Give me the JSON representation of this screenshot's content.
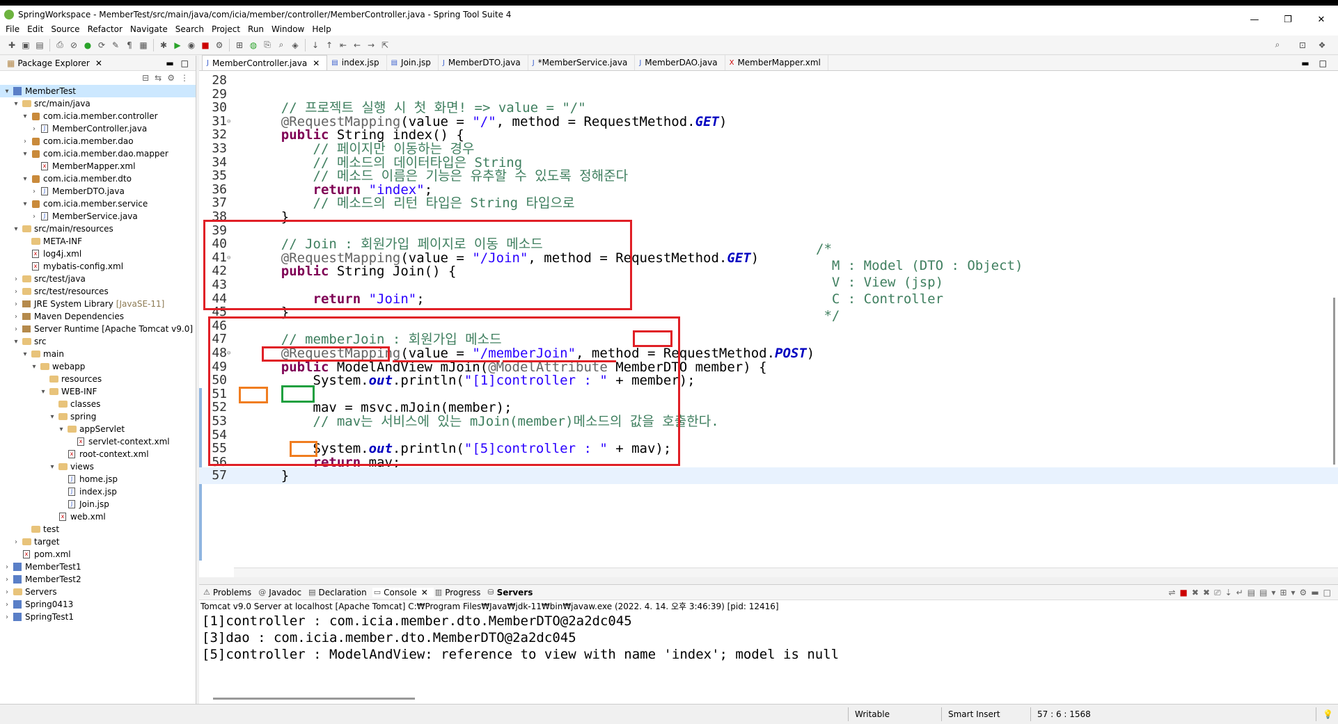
{
  "window": {
    "title": "SpringWorkspace - MemberTest/src/main/java/com/icia/member/controller/MemberController.java - Spring Tool Suite 4",
    "minimize": "—",
    "restore": "❐",
    "close": "✕"
  },
  "menu": [
    "File",
    "Edit",
    "Source",
    "Refactor",
    "Navigate",
    "Search",
    "Project",
    "Run",
    "Window",
    "Help"
  ],
  "package_explorer": {
    "title": "Package Explorer",
    "tree": [
      {
        "label": "MemberTest",
        "depth": 0,
        "arrow": "▾",
        "icon": "project",
        "selected": true
      },
      {
        "label": "src/main/java",
        "depth": 1,
        "arrow": "▾",
        "icon": "folder"
      },
      {
        "label": "com.icia.member.controller",
        "depth": 2,
        "arrow": "▾",
        "icon": "package"
      },
      {
        "label": "MemberController.java",
        "depth": 3,
        "arrow": "›",
        "icon": "java"
      },
      {
        "label": "com.icia.member.dao",
        "depth": 2,
        "arrow": "›",
        "icon": "package"
      },
      {
        "label": "com.icia.member.dao.mapper",
        "depth": 2,
        "arrow": "▾",
        "icon": "package"
      },
      {
        "label": "MemberMapper.xml",
        "depth": 3,
        "arrow": "",
        "icon": "xml"
      },
      {
        "label": "com.icia.member.dto",
        "depth": 2,
        "arrow": "▾",
        "icon": "package"
      },
      {
        "label": "MemberDTO.java",
        "depth": 3,
        "arrow": "›",
        "icon": "java"
      },
      {
        "label": "com.icia.member.service",
        "depth": 2,
        "arrow": "▾",
        "icon": "package"
      },
      {
        "label": "MemberService.java",
        "depth": 3,
        "arrow": "›",
        "icon": "java"
      },
      {
        "label": "src/main/resources",
        "depth": 1,
        "arrow": "▾",
        "icon": "folder"
      },
      {
        "label": "META-INF",
        "depth": 2,
        "arrow": "",
        "icon": "folder"
      },
      {
        "label": "log4j.xml",
        "depth": 2,
        "arrow": "",
        "icon": "xml"
      },
      {
        "label": "mybatis-config.xml",
        "depth": 2,
        "arrow": "",
        "icon": "xml"
      },
      {
        "label": "src/test/java",
        "depth": 1,
        "arrow": "›",
        "icon": "folder"
      },
      {
        "label": "src/test/resources",
        "depth": 1,
        "arrow": "›",
        "icon": "folder"
      },
      {
        "label": "JRE System Library",
        "suffix": "[JavaSE-11]",
        "depth": 1,
        "arrow": "›",
        "icon": "library"
      },
      {
        "label": "Maven Dependencies",
        "depth": 1,
        "arrow": "›",
        "icon": "library"
      },
      {
        "label": "Server Runtime [Apache Tomcat v9.0]",
        "depth": 1,
        "arrow": "›",
        "icon": "library"
      },
      {
        "label": "src",
        "depth": 1,
        "arrow": "▾",
        "icon": "folder"
      },
      {
        "label": "main",
        "depth": 2,
        "arrow": "▾",
        "icon": "folder"
      },
      {
        "label": "webapp",
        "depth": 3,
        "arrow": "▾",
        "icon": "folder"
      },
      {
        "label": "resources",
        "depth": 4,
        "arrow": "",
        "icon": "folder"
      },
      {
        "label": "WEB-INF",
        "depth": 4,
        "arrow": "▾",
        "icon": "folder"
      },
      {
        "label": "classes",
        "depth": 5,
        "arrow": "",
        "icon": "folder"
      },
      {
        "label": "spring",
        "depth": 5,
        "arrow": "▾",
        "icon": "folder"
      },
      {
        "label": "appServlet",
        "depth": 6,
        "arrow": "▾",
        "icon": "folder"
      },
      {
        "label": "servlet-context.xml",
        "depth": 7,
        "arrow": "",
        "icon": "xml"
      },
      {
        "label": "root-context.xml",
        "depth": 6,
        "arrow": "",
        "icon": "xml"
      },
      {
        "label": "views",
        "depth": 5,
        "arrow": "▾",
        "icon": "folder"
      },
      {
        "label": "home.jsp",
        "depth": 6,
        "arrow": "",
        "icon": "jsp"
      },
      {
        "label": "index.jsp",
        "depth": 6,
        "arrow": "",
        "icon": "jsp"
      },
      {
        "label": "Join.jsp",
        "depth": 6,
        "arrow": "",
        "icon": "jsp"
      },
      {
        "label": "web.xml",
        "depth": 5,
        "arrow": "",
        "icon": "xml"
      },
      {
        "label": "test",
        "depth": 2,
        "arrow": "",
        "icon": "folder"
      },
      {
        "label": "target",
        "depth": 1,
        "arrow": "›",
        "icon": "folder"
      },
      {
        "label": "pom.xml",
        "depth": 1,
        "arrow": "",
        "icon": "xml"
      },
      {
        "label": "MemberTest1",
        "depth": 0,
        "arrow": "›",
        "icon": "project"
      },
      {
        "label": "MemberTest2",
        "depth": 0,
        "arrow": "›",
        "icon": "project"
      },
      {
        "label": "Servers",
        "depth": 0,
        "arrow": "›",
        "icon": "folder"
      },
      {
        "label": "Spring0413",
        "depth": 0,
        "arrow": "›",
        "icon": "project"
      },
      {
        "label": "SpringTest1",
        "depth": 0,
        "arrow": "›",
        "icon": "project"
      }
    ]
  },
  "editor": {
    "tabs": [
      {
        "label": "MemberController.java",
        "active": true,
        "icon": "J"
      },
      {
        "label": "index.jsp",
        "active": false,
        "icon": "▤"
      },
      {
        "label": "Join.jsp",
        "active": false,
        "icon": "▤"
      },
      {
        "label": "MemberDTO.java",
        "active": false,
        "icon": "J"
      },
      {
        "label": "*MemberService.java",
        "active": false,
        "icon": "J"
      },
      {
        "label": "MemberDAO.java",
        "active": false,
        "icon": "J"
      },
      {
        "label": "MemberMapper.xml",
        "active": false,
        "icon": "X"
      }
    ],
    "lines": [
      {
        "n": "28",
        "parts": []
      },
      {
        "n": "29",
        "parts": []
      },
      {
        "n": "30",
        "parts": [
          {
            "t": "    ",
            "c": ""
          },
          {
            "t": "// 프로젝트 실행 시 첫 화면! => value = \"/\"",
            "c": "cm"
          }
        ]
      },
      {
        "n": "31",
        "fold": "⊖",
        "parts": [
          {
            "t": "    ",
            "c": ""
          },
          {
            "t": "@RequestMapping",
            "c": "ann"
          },
          {
            "t": "(value = ",
            "c": ""
          },
          {
            "t": "\"/\"",
            "c": "str"
          },
          {
            "t": ", method = RequestMethod.",
            "c": ""
          },
          {
            "t": "GET",
            "c": "stat"
          },
          {
            "t": ")",
            "c": ""
          }
        ]
      },
      {
        "n": "32",
        "parts": [
          {
            "t": "    ",
            "c": ""
          },
          {
            "t": "public",
            "c": "kw"
          },
          {
            "t": " String index() {",
            "c": ""
          }
        ]
      },
      {
        "n": "33",
        "parts": [
          {
            "t": "        ",
            "c": ""
          },
          {
            "t": "// 페이지만 이동하는 경우",
            "c": "cm"
          }
        ]
      },
      {
        "n": "34",
        "parts": [
          {
            "t": "        ",
            "c": ""
          },
          {
            "t": "// 메소드의 데이터타입은 String",
            "c": "cm"
          }
        ]
      },
      {
        "n": "35",
        "parts": [
          {
            "t": "        ",
            "c": ""
          },
          {
            "t": "// 메소드 이름은 기능은 유추할 수 있도록 정해준다",
            "c": "cm"
          }
        ]
      },
      {
        "n": "36",
        "parts": [
          {
            "t": "        ",
            "c": ""
          },
          {
            "t": "return",
            "c": "kw"
          },
          {
            "t": " ",
            "c": ""
          },
          {
            "t": "\"index\"",
            "c": "str"
          },
          {
            "t": ";",
            "c": ""
          }
        ]
      },
      {
        "n": "37",
        "parts": [
          {
            "t": "        ",
            "c": ""
          },
          {
            "t": "// 메소드의 리턴 타입은 String 타입으로",
            "c": "cm"
          }
        ]
      },
      {
        "n": "38",
        "parts": [
          {
            "t": "    }",
            "c": ""
          }
        ]
      },
      {
        "n": "39",
        "parts": []
      },
      {
        "n": "40",
        "parts": [
          {
            "t": "    ",
            "c": ""
          },
          {
            "t": "// Join : 회원가입 페이지로 이동 메소드",
            "c": "cm"
          }
        ]
      },
      {
        "n": "41",
        "fold": "⊖",
        "parts": [
          {
            "t": "    ",
            "c": ""
          },
          {
            "t": "@RequestMapping",
            "c": "ann"
          },
          {
            "t": "(value = ",
            "c": ""
          },
          {
            "t": "\"/Join\"",
            "c": "str"
          },
          {
            "t": ", method = RequestMethod.",
            "c": ""
          },
          {
            "t": "GET",
            "c": "stat"
          },
          {
            "t": ")",
            "c": ""
          }
        ]
      },
      {
        "n": "42",
        "parts": [
          {
            "t": "    ",
            "c": ""
          },
          {
            "t": "public",
            "c": "kw"
          },
          {
            "t": " String Join() {",
            "c": ""
          }
        ]
      },
      {
        "n": "43",
        "parts": []
      },
      {
        "n": "44",
        "parts": [
          {
            "t": "        ",
            "c": ""
          },
          {
            "t": "return",
            "c": "kw"
          },
          {
            "t": " ",
            "c": ""
          },
          {
            "t": "\"Join\"",
            "c": "str"
          },
          {
            "t": ";",
            "c": ""
          }
        ]
      },
      {
        "n": "45",
        "parts": [
          {
            "t": "    }",
            "c": ""
          }
        ]
      },
      {
        "n": "46",
        "parts": []
      },
      {
        "n": "47",
        "parts": [
          {
            "t": "    ",
            "c": ""
          },
          {
            "t": "// memberJoin : 회원가입 메소드",
            "c": "cm"
          }
        ]
      },
      {
        "n": "48",
        "fold": "⊖",
        "parts": [
          {
            "t": "    ",
            "c": ""
          },
          {
            "t": "@RequestMapping",
            "c": "ann"
          },
          {
            "t": "(value = ",
            "c": ""
          },
          {
            "t": "\"/memberJoin\"",
            "c": "str"
          },
          {
            "t": ", method = RequestMethod.",
            "c": ""
          },
          {
            "t": "POST",
            "c": "stat"
          },
          {
            "t": ")",
            "c": ""
          }
        ]
      },
      {
        "n": "49",
        "parts": [
          {
            "t": "    ",
            "c": ""
          },
          {
            "t": "public",
            "c": "kw"
          },
          {
            "t": " ModelAndView mJoin(",
            "c": ""
          },
          {
            "t": "@ModelAttribute",
            "c": "ann"
          },
          {
            "t": " MemberDTO member) {",
            "c": ""
          }
        ]
      },
      {
        "n": "50",
        "parts": [
          {
            "t": "        System.",
            "c": ""
          },
          {
            "t": "out",
            "c": "stat"
          },
          {
            "t": ".println(",
            "c": ""
          },
          {
            "t": "\"[1]controller : \"",
            "c": "str"
          },
          {
            "t": " + member);",
            "c": ""
          }
        ]
      },
      {
        "n": "51",
        "parts": []
      },
      {
        "n": "52",
        "parts": [
          {
            "t": "        mav = msvc.mJoin(member);",
            "c": ""
          }
        ]
      },
      {
        "n": "53",
        "parts": [
          {
            "t": "        ",
            "c": ""
          },
          {
            "t": "// mav는 서비스에 있는 mJoin(member)메소드의 값을 호출한다.",
            "c": "cm"
          }
        ]
      },
      {
        "n": "54",
        "parts": []
      },
      {
        "n": "55",
        "parts": [
          {
            "t": "        System.",
            "c": ""
          },
          {
            "t": "out",
            "c": "stat"
          },
          {
            "t": ".println(",
            "c": ""
          },
          {
            "t": "\"[5]controller : \"",
            "c": "str"
          },
          {
            "t": " + mav);",
            "c": ""
          }
        ]
      },
      {
        "n": "56",
        "parts": [
          {
            "t": "        ",
            "c": ""
          },
          {
            "t": "return",
            "c": "kw"
          },
          {
            "t": " mav;",
            "c": ""
          }
        ]
      },
      {
        "n": "57",
        "cur": true,
        "parts": [
          {
            "t": "    }",
            "c": ""
          }
        ]
      }
    ],
    "side_comment": [
      "/*",
      "  M : Model (DTO : Object)",
      "  V : View (jsp)",
      "  C : Controller",
      " */"
    ]
  },
  "console": {
    "tabs": [
      {
        "label": "Problems",
        "icon": "⚠"
      },
      {
        "label": "Javadoc",
        "icon": "@"
      },
      {
        "label": "Declaration",
        "icon": "▤"
      },
      {
        "label": "Console",
        "icon": "▭",
        "active": true
      },
      {
        "label": "Progress",
        "icon": "▥"
      },
      {
        "label": "Servers",
        "icon": "⛁",
        "bold": true
      }
    ],
    "info": "Tomcat v9.0 Server at localhost [Apache Tomcat] C:₩Program Files₩Java₩jdk-11₩bin₩javaw.exe  (2022. 4. 14. 오후 3:46:39) [pid: 12416]",
    "output": [
      "[1]controller : com.icia.member.dto.MemberDTO@2a2dc045",
      "[3]dao : com.icia.member.dto.MemberDTO@2a2dc045",
      "[5]controller : ModelAndView: reference to view with name 'index'; model is null"
    ]
  },
  "statusbar": {
    "writable": "Writable",
    "insert_mode": "Smart Insert",
    "position": "57 : 6 : 1568"
  },
  "colors": {
    "keyword": "#7f0055",
    "comment": "#3f7f5f",
    "string": "#2a00ff",
    "annotation": "#646464",
    "static_field": "#0000c0",
    "highlight_red": "#e01f26",
    "highlight_orange": "#f07d20",
    "highlight_green": "#1fa040"
  }
}
